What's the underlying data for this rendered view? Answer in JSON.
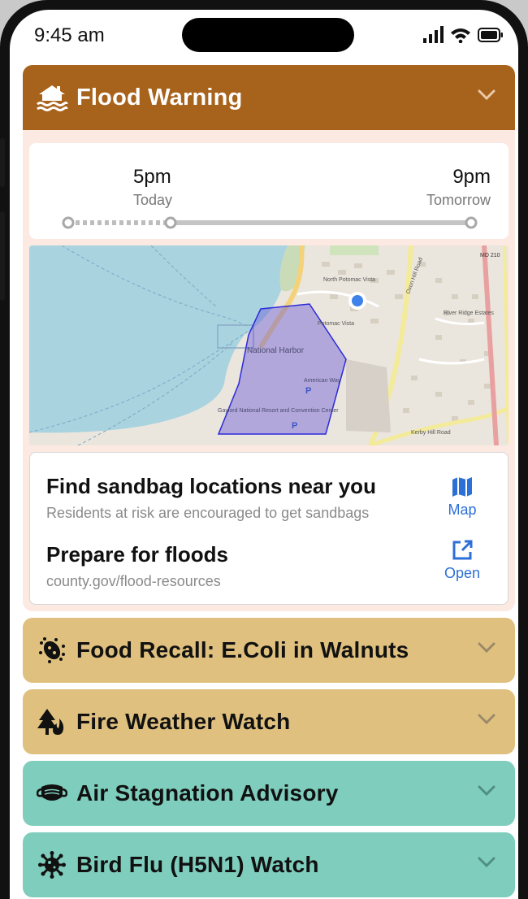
{
  "status_bar": {
    "time": "9:45 am",
    "icons": [
      "signal-icon",
      "wifi-icon",
      "battery-icon"
    ]
  },
  "flood_card": {
    "title": "Flood Warning",
    "icon": "flood-house-icon",
    "header_color": "#a7621c",
    "timeline": {
      "start_time": "5pm",
      "start_day": "Today",
      "end_time": "9pm",
      "end_day": "Tomorrow"
    },
    "map": {
      "labels": {
        "harbor": "National Harbor",
        "north_potomac": "North Potomac Vista",
        "potomac_vista": "Potomac Vista",
        "gaylord": "Gaylord National Resort and Convention Center",
        "american_way": "American Way",
        "river_ridge": "River Ridge Estates",
        "route": "MD 210",
        "oxon_hill": "Oxon Hill Road",
        "kerby_hill": "Kerby Hill Road",
        "parking": "P"
      }
    },
    "sandbag": {
      "title": "Find sandbag locations near you",
      "subtitle": "Residents at risk are encouraged to get sandbags",
      "action_label": "Map",
      "action_icon": "map-icon"
    },
    "prepare": {
      "title": "Prepare for floods",
      "subtitle": "county.gov/flood-resources",
      "action_label": "Open",
      "action_icon": "external-link-icon"
    }
  },
  "alerts": [
    {
      "title": "Food Recall: E.Coli in Walnuts",
      "icon": "bacteria-icon",
      "color": "#dfc07e"
    },
    {
      "title": "Fire Weather Watch",
      "icon": "fire-tree-icon",
      "color": "#dfc07e"
    },
    {
      "title": "Air Stagnation Advisory",
      "icon": "mask-icon",
      "color": "#7fcdbd"
    },
    {
      "title": "Bird Flu (H5N1) Watch",
      "icon": "virus-icon",
      "color": "#7fcdbd"
    }
  ],
  "colors": {
    "link": "#2c6fd6",
    "flood_area": "#6a5ad6",
    "water": "#a9d3df",
    "location_dot": "#3d82ea"
  }
}
